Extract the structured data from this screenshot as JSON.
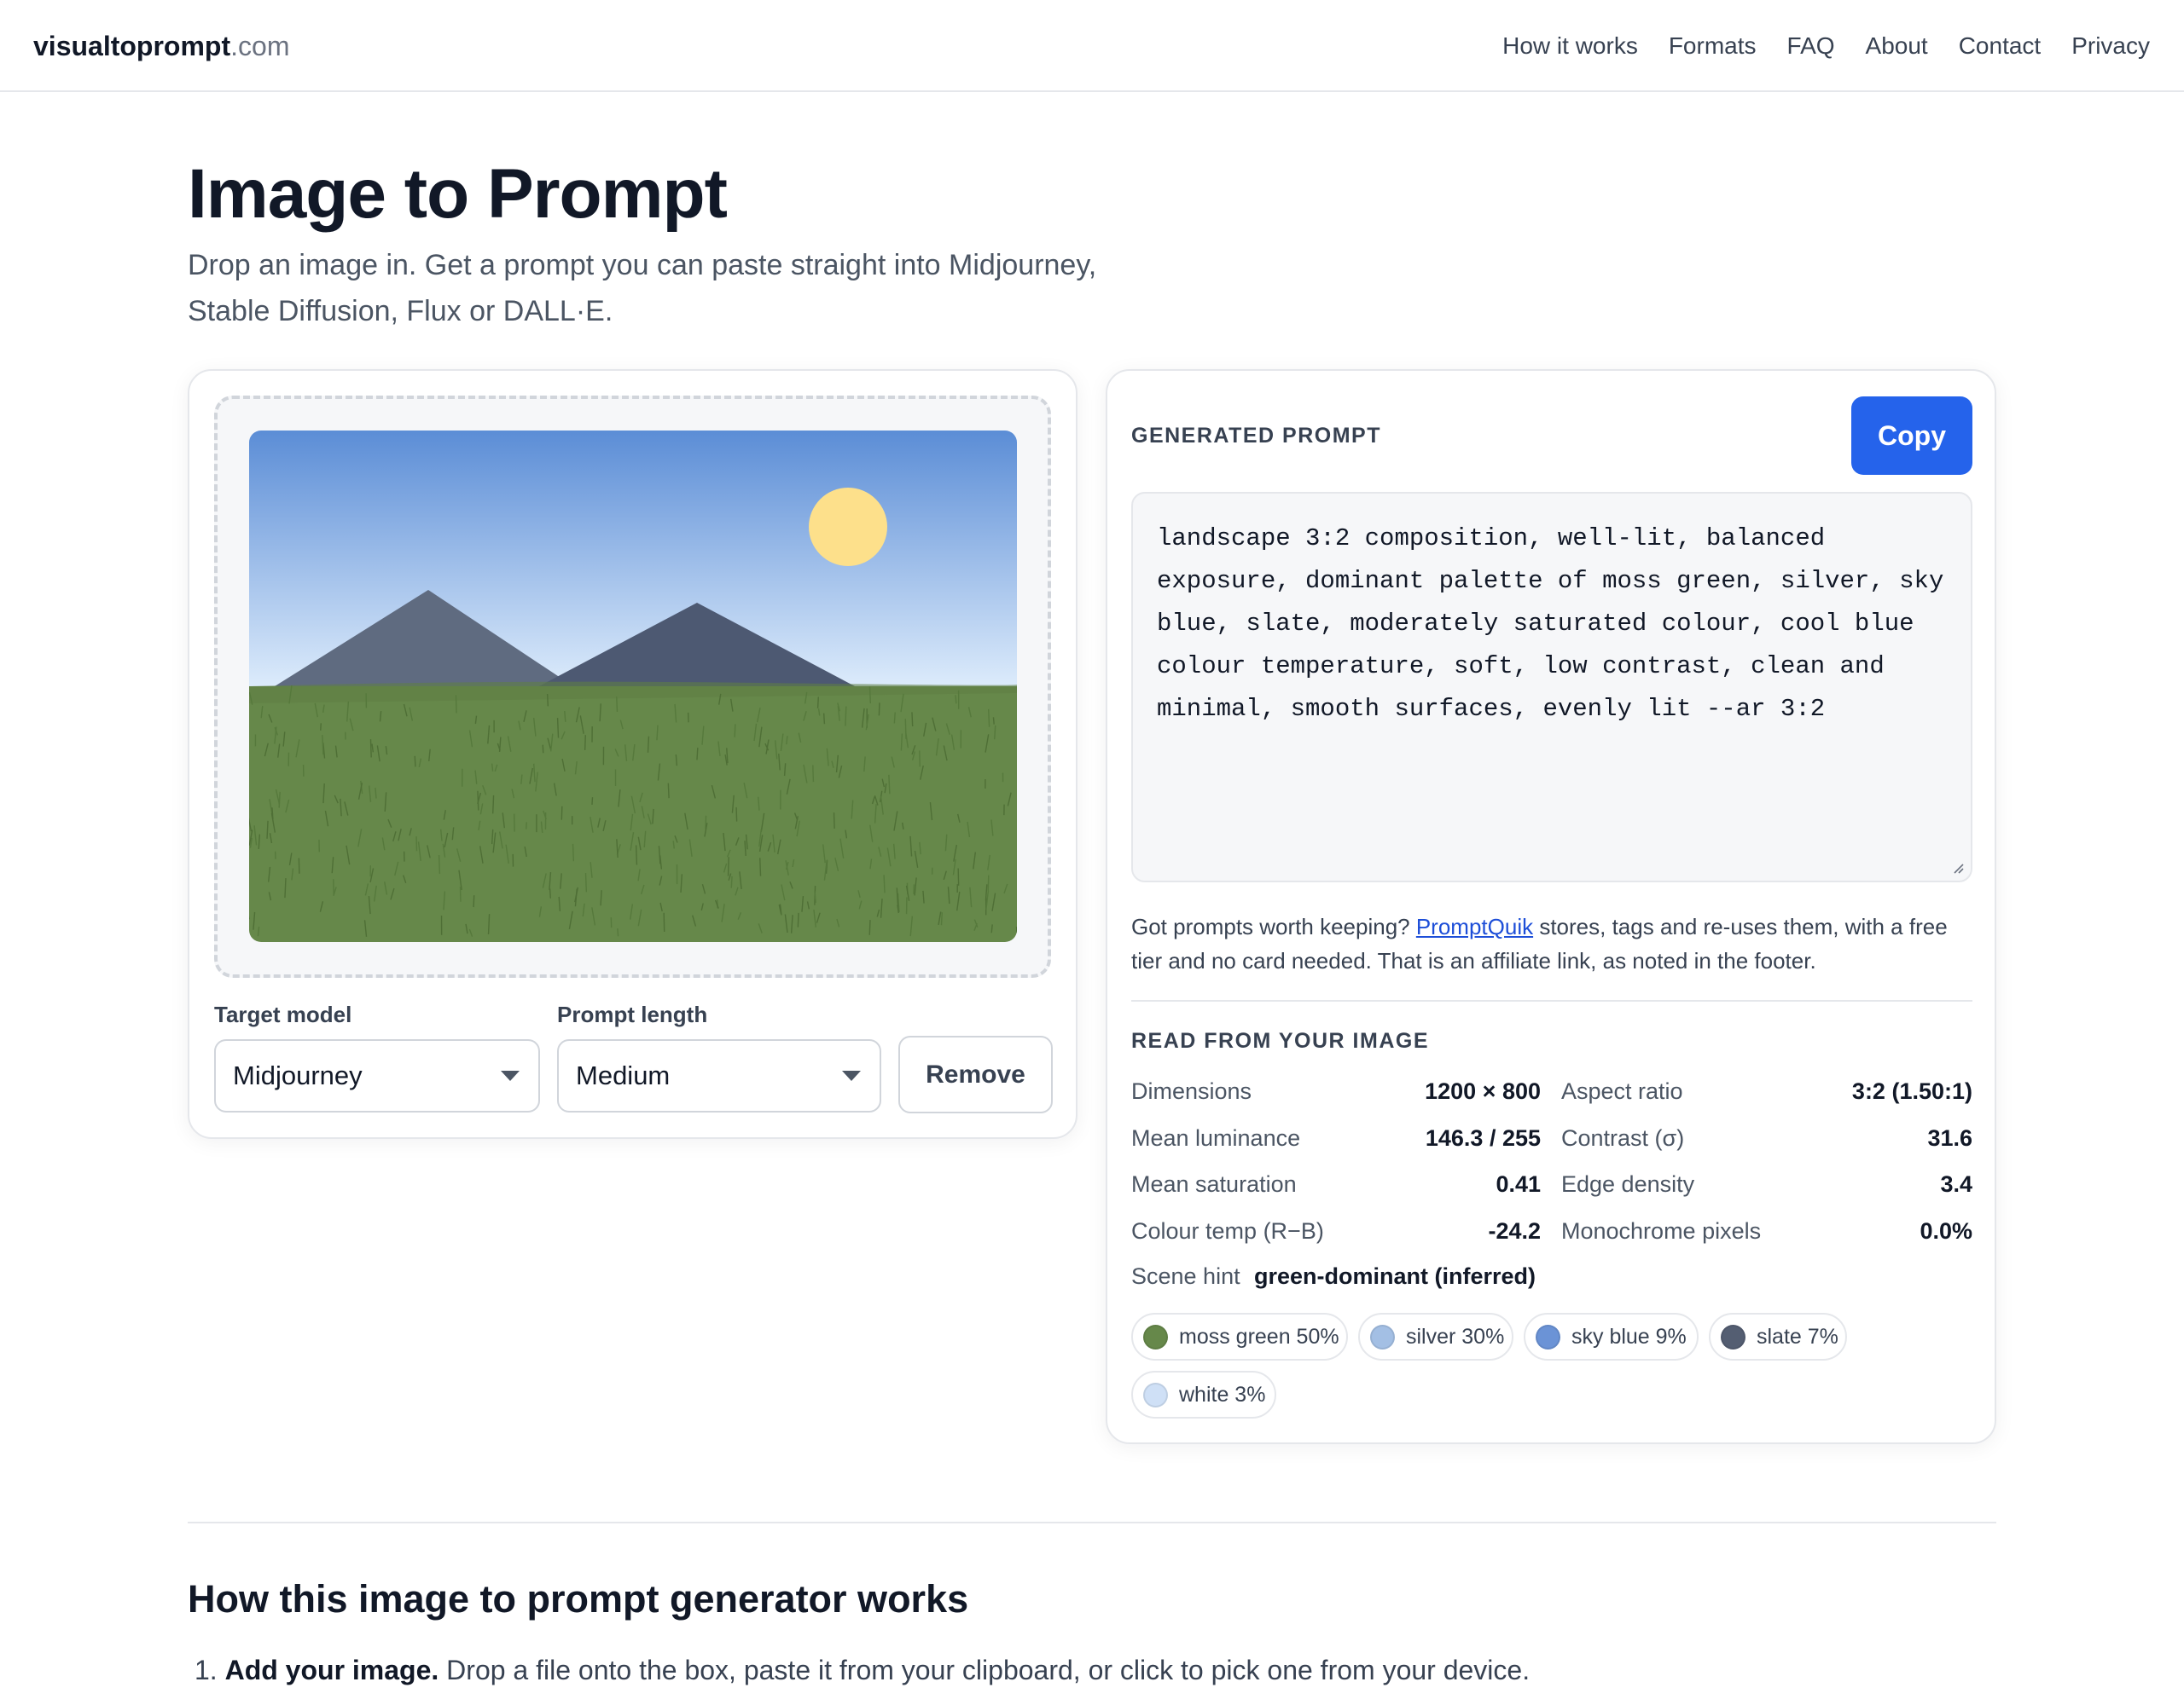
{
  "header": {
    "logo_bold": "visualtoprompt",
    "logo_suffix": ".com",
    "nav": [
      "How it works",
      "Formats",
      "FAQ",
      "About",
      "Contact",
      "Privacy"
    ]
  },
  "hero": {
    "title": "Image to Prompt",
    "subtitle": "Drop an image in. Get a prompt you can paste straight into Midjourney, Stable Diffusion, Flux or DALL·E."
  },
  "uploader": {
    "target_model_label": "Target model",
    "target_model_value": "Midjourney",
    "prompt_length_label": "Prompt length",
    "prompt_length_value": "Medium",
    "remove_label": "Remove"
  },
  "output": {
    "heading": "GENERATED PROMPT",
    "copy_label": "Copy",
    "prompt_text": "landscape 3:2 composition, well-lit, balanced exposure, dominant palette of moss green, silver, sky blue, slate, moderately saturated colour, cool blue colour temperature, soft, low contrast, clean and minimal, smooth surfaces, evenly lit --ar 3:2",
    "affiliate_before": "Got prompts worth keeping? ",
    "affiliate_link": "PromptQuik",
    "affiliate_after": " stores, tags and re-uses them, with a free tier and no card needed. That is an affiliate link, as noted in the footer."
  },
  "analysis": {
    "heading": "READ FROM YOUR IMAGE",
    "stats": [
      {
        "label": "Dimensions",
        "value": "1200 × 800"
      },
      {
        "label": "Aspect ratio",
        "value": "3:2 (1.50:1)"
      },
      {
        "label": "Mean luminance",
        "value": "146.3 / 255"
      },
      {
        "label": "Contrast (σ)",
        "value": "31.6"
      },
      {
        "label": "Mean saturation",
        "value": "0.41"
      },
      {
        "label": "Edge density",
        "value": "3.4"
      },
      {
        "label": "Colour temp (R−B)",
        "value": "-24.2"
      },
      {
        "label": "Monochrome pixels",
        "value": "0.0%"
      }
    ],
    "scene_hint_label": "Scene hint",
    "scene_hint_value": "green-dominant (inferred)",
    "palette": [
      {
        "label": "moss green 50%",
        "color": "#66884a"
      },
      {
        "label": "silver 30%",
        "color": "#a3bfe4"
      },
      {
        "label": "sky blue 9%",
        "color": "#6b93d6"
      },
      {
        "label": "slate 7%",
        "color": "#545e72"
      },
      {
        "label": "white 3%",
        "color": "#cfe0f6"
      }
    ]
  },
  "how_it_works": {
    "heading": "How this image to prompt generator works",
    "step1_number": "1.",
    "step1_bold": "Add your image.",
    "step1_text": " Drop a file onto the box, paste it from your clipboard, or click to pick one from your device."
  },
  "colors": {
    "accent": "#2563eb",
    "link": "#1d4ed8",
    "border": "#e5e7eb",
    "sky_top": "#5b8dd6",
    "sky_bottom": "#dcebfb",
    "grass": "#66884a",
    "sun": "#fde08b",
    "mountain_left": "#5f6b80",
    "mountain_right": "#4d5972"
  }
}
